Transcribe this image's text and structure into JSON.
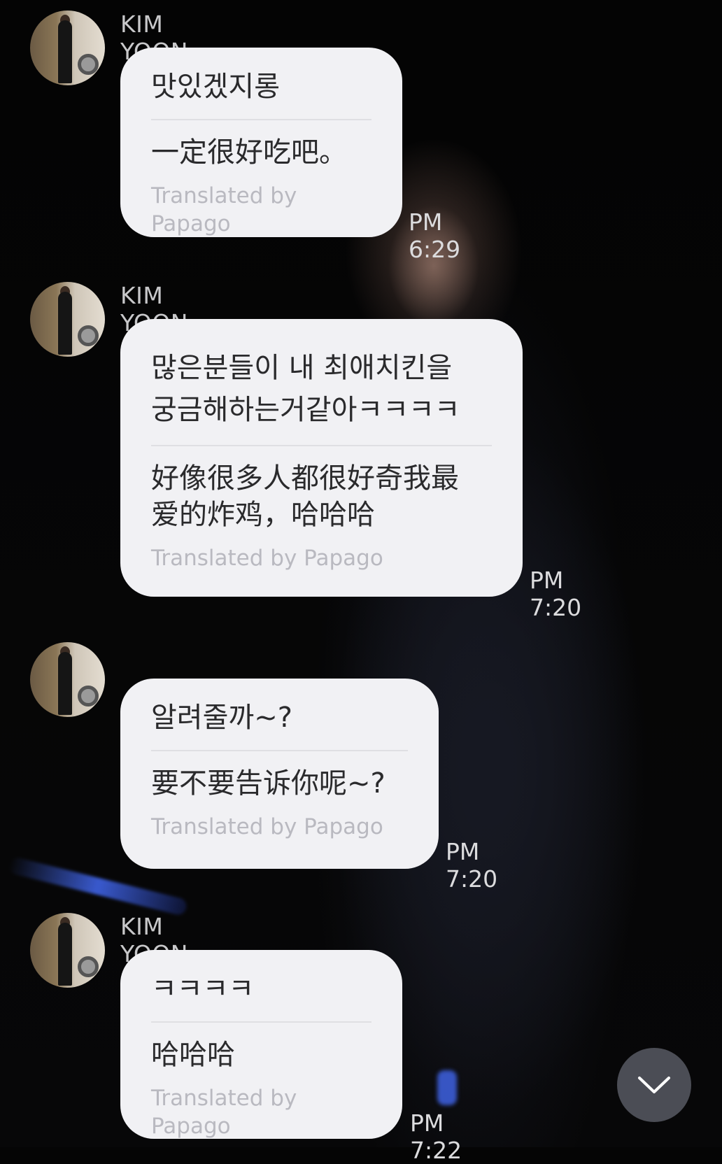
{
  "messages": [
    {
      "sender": "KIM YOON SIK",
      "original": "맛있겠지롱",
      "translation": "一定很好吃吧。",
      "credit": "Translated by Papago",
      "time": "PM 6:29"
    },
    {
      "sender": "KIM YOON SIK",
      "original": "많은분들이 내 최애치킨을\n궁금해하는거같아ㅋㅋㅋㅋ",
      "translation": "好像很多人都很好奇我最\n爱的炸鸡，哈哈哈",
      "credit": "Translated by Papago",
      "time": "PM 7:20"
    },
    {
      "sender": "",
      "original": "알려줄까~?",
      "translation": "要不要告诉你呢~?",
      "credit": "Translated by Papago",
      "time": "PM 7:20"
    },
    {
      "sender": "KIM YOON SIK",
      "original": "ㅋㅋㅋㅋ",
      "translation": "哈哈哈",
      "credit": "Translated by Papago",
      "time": "PM 7:22"
    }
  ],
  "scroll_button_icon": "chevron-down-icon"
}
